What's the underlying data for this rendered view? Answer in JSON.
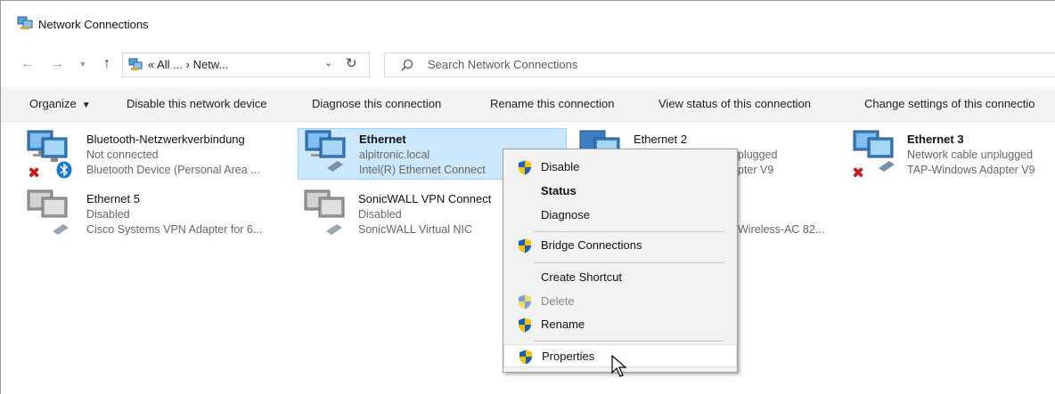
{
  "window": {
    "title": "Network Connections"
  },
  "address_bar": {
    "path": "« All ... › Netw...",
    "search_placeholder": "Search Network Connections"
  },
  "icons": {
    "back": "back-arrow-icon",
    "forward": "forward-arrow-icon",
    "recent": "chevron-down-icon",
    "up": "up-arrow-icon",
    "refresh": "refresh-icon",
    "search": "search-icon",
    "shield": "uac-shield-icon",
    "cursor": "mouse-pointer-icon"
  },
  "toolbar": {
    "organize": "Organize",
    "disable": "Disable this network device",
    "diagnose": "Diagnose this connection",
    "rename": "Rename this connection",
    "view_status": "View status of this connection",
    "change_settings": "Change settings of this connectio"
  },
  "connections": [
    {
      "name": "Bluetooth-Netzwerkverbindung",
      "status": "Not connected",
      "device": "Bluetooth Device (Personal Area ...",
      "badge": "red-x",
      "extra": "bluetooth"
    },
    {
      "name": "Ethernet",
      "status": "alpitronic.local",
      "device": "Intel(R) Ethernet Connect",
      "badge": "cable",
      "selected": true
    },
    {
      "name": "Ethernet 2",
      "status": "plugged",
      "device": "pter V9",
      "badge": "cable"
    },
    {
      "name": "Ethernet 3",
      "status": "Network cable unplugged",
      "device": "TAP-Windows Adapter V9",
      "badge": "red-x"
    },
    {
      "name": "Ethernet 5",
      "status": "Disabled",
      "device": "Cisco Systems VPN Adapter for 6...",
      "badge": "cable"
    },
    {
      "name": "SonicWALL VPN Connect",
      "status": "Disabled",
      "device": "SonicWALL Virtual NIC",
      "badge": "cable"
    },
    {
      "name": "",
      "status": "",
      "device": "Wireless-AC 82...",
      "badge": "none"
    }
  ],
  "context_menu": {
    "items": [
      {
        "label": "Disable",
        "shield": true,
        "style": "normal"
      },
      {
        "label": "Status",
        "shield": false,
        "style": "bold"
      },
      {
        "label": "Diagnose",
        "shield": false,
        "style": "normal"
      },
      {
        "label": "Bridge Connections",
        "shield": true,
        "style": "normal"
      },
      {
        "label": "Create Shortcut",
        "shield": false,
        "style": "normal"
      },
      {
        "label": "Delete",
        "shield": true,
        "style": "disabled"
      },
      {
        "label": "Rename",
        "shield": true,
        "style": "normal"
      },
      {
        "label": "Properties",
        "shield": true,
        "style": "hover"
      }
    ]
  },
  "colors": {
    "selection": "#cce8ff",
    "selection_border": "#99d1ff",
    "shield_blue": "#1c5fb8",
    "shield_yellow": "#f5c400",
    "error_red": "#d01616"
  }
}
